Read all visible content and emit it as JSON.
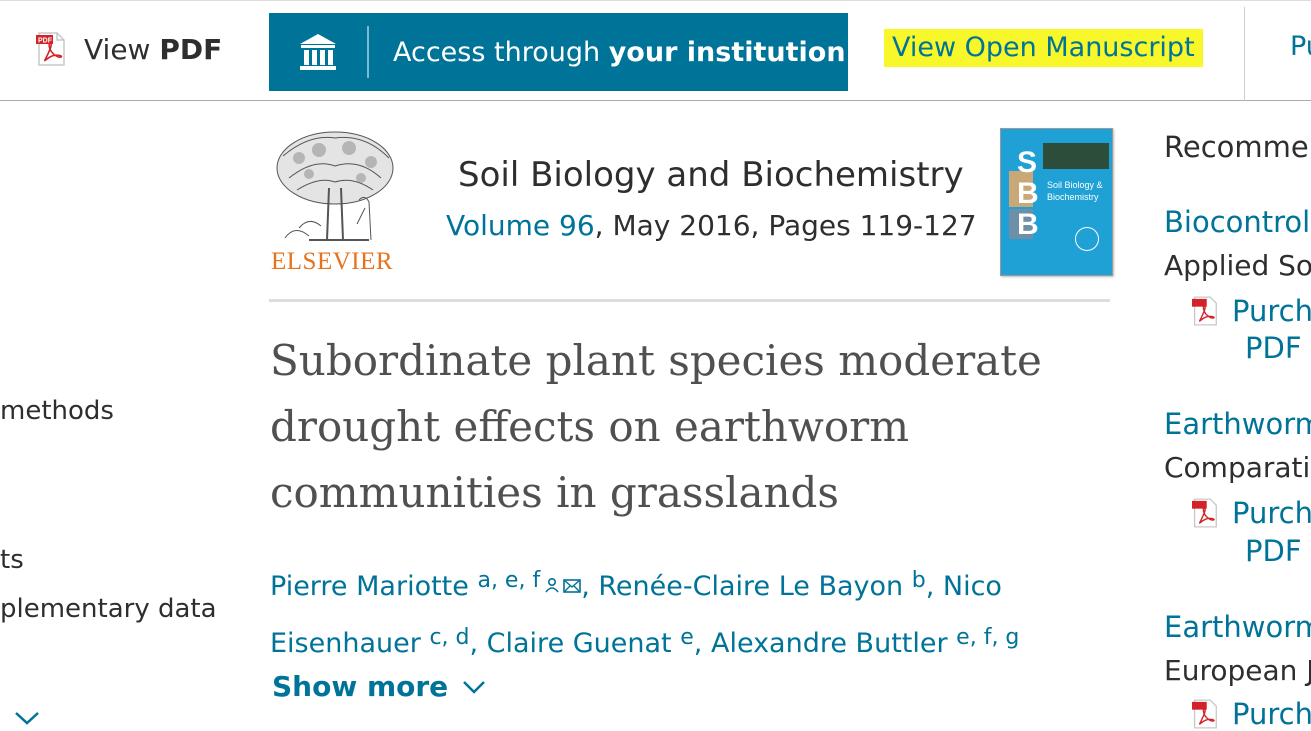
{
  "toolbar": {
    "view_label": "View",
    "pdf_label": "PDF",
    "access_prefix": "Access through",
    "access_bold": "your institution",
    "open_manuscript": "View Open Manuscript",
    "partial_right": "Pu"
  },
  "left_nav": {
    "item_methods": "methods",
    "item_ts": "ts",
    "item_supplementary": "plementary data"
  },
  "article": {
    "journal": "Soil Biology and Biochemistry",
    "volume_link": "Volume 96",
    "volume_rest": ", May 2016, Pages 119-127",
    "publisher_logo_text": "ELSEVIER",
    "cover_text": "SBB",
    "cover_subtitle": "Soil Biology & Biochemistry",
    "title": "Subordinate plant species moderate drought effects on earthworm communities in grasslands",
    "authors": [
      {
        "name": "Pierre Mariotte",
        "sup": "a, e, f",
        "sep": ", "
      },
      {
        "name": "Renée-Claire Le Bayon",
        "sup": "b",
        "sep": ", "
      },
      {
        "name": "Nico Eisenhauer",
        "sup": "c, d",
        "sep": ", "
      },
      {
        "name": "Claire Guenat",
        "sup": "e",
        "sep": ", "
      },
      {
        "name": "Alexandre Buttler",
        "sup": "e, f, g",
        "sep": ""
      }
    ],
    "show_more": "Show more"
  },
  "recommended": {
    "heading": "Recommen",
    "items": [
      {
        "title": "Biocontrol",
        "journal": "Applied Soi",
        "purchase_1": "Purch",
        "purchase_2": "PDF"
      },
      {
        "title": "Earthworm",
        "journal": "Comparativ",
        "purchase_1": "Purch",
        "purchase_2": "PDF"
      },
      {
        "title": "Earthworm",
        "journal": "European J",
        "purchase_1": "Purch",
        "purchase_2": ""
      }
    ]
  },
  "colors": {
    "brand_blue": "#007398",
    "highlight_yellow": "#f7f72a",
    "elsevier_orange": "#e9711c",
    "pdf_red": "#d2232a"
  }
}
